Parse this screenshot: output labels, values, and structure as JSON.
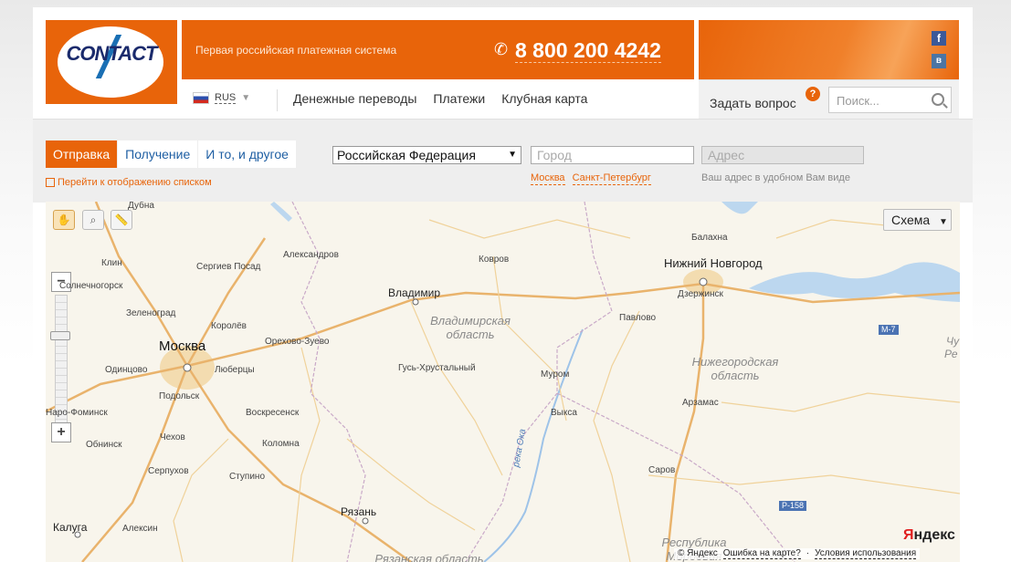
{
  "header": {
    "logo_text": "CONTACT",
    "tagline": "Первая российская платежная система",
    "phone": "8 800 200 4242",
    "social": {
      "facebook": "f",
      "vk": "в"
    }
  },
  "language": {
    "selected": "RUS"
  },
  "nav": {
    "items": [
      "Денежные переводы",
      "Платежи",
      "Клубная карта"
    ]
  },
  "ask": {
    "label": "Задать вопрос",
    "badge": "?"
  },
  "search": {
    "placeholder": "Поиск..."
  },
  "filter": {
    "tabs": [
      "Отправка",
      "Получение",
      "И то, и другое"
    ],
    "active_tab": "Отправка",
    "list_link": "Перейти к отображению списком",
    "country": "Российская Федерация",
    "city_placeholder": "Город",
    "address_placeholder": "Адрес",
    "quick_cities": [
      "Москва",
      "Санкт-Петербург"
    ],
    "address_hint": "Ваш адрес в удобном Вам виде"
  },
  "map": {
    "scheme_label": "Схема",
    "zoom_in": "+",
    "zoom_out": "−",
    "brand": {
      "first": "Я",
      "rest": "ндекс"
    },
    "footer": {
      "copyright": "© Яндекс",
      "error_link": "Ошибка на карте?",
      "dot": "·",
      "terms_link": "Условия использования"
    },
    "big_cities": [
      "Москва",
      "Нижний Новгород"
    ],
    "cities": [
      "Владимир",
      "Рязань",
      "Калуга",
      "Ковров",
      "Балахна",
      "Дзержинск",
      "Павлово",
      "Муром",
      "Выкса",
      "Арзамас",
      "Саров"
    ],
    "towns": [
      "Дубна",
      "Клин",
      "Сергиев Посад",
      "Александров",
      "Солнечногорск",
      "Зеленоград",
      "Королёв",
      "Орехово-Зуево",
      "Одинцово",
      "Люберцы",
      "Подольск",
      "Гусь-Хрустальный",
      "Наро-Фоминск",
      "Воскресенск",
      "Обнинск",
      "Чехов",
      "Коломна",
      "Серпухов",
      "Ступино",
      "Алексин"
    ],
    "regions": [
      {
        "line1": "Владимирская",
        "line2": "область"
      },
      {
        "line1": "Нижегородская",
        "line2": "область"
      },
      {
        "line1": "Республика",
        "line2": "Мордовия"
      },
      {
        "line1": "Рязанская область",
        "line2": ""
      }
    ],
    "river": "река Ока",
    "roads": [
      "M-7",
      "P-158"
    ],
    "edge_labels": [
      "Чу",
      "Ре"
    ]
  }
}
